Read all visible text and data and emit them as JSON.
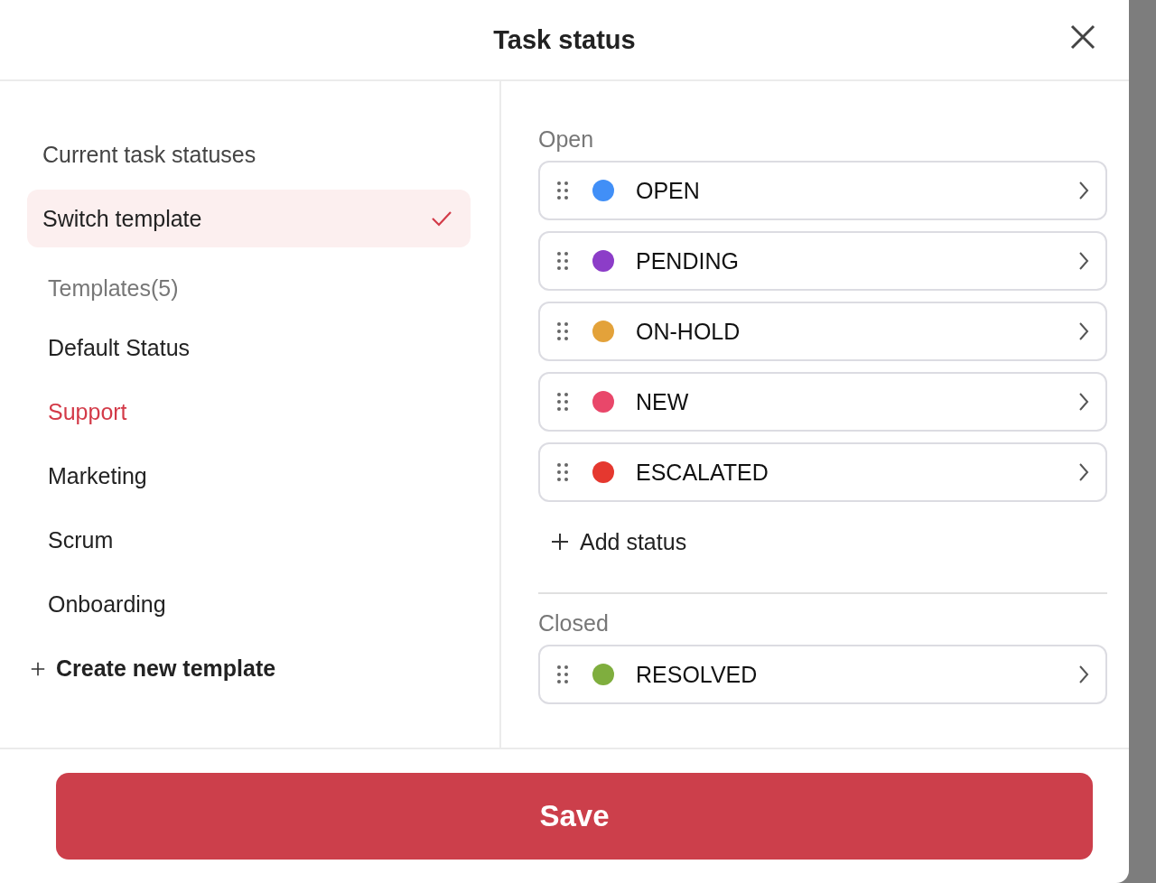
{
  "dialog": {
    "title": "Task status"
  },
  "sidebar": {
    "heading": "Current task statuses",
    "switch": {
      "label": "Switch template",
      "checked": true
    },
    "templates_label": "Templates(5)",
    "templates": [
      {
        "label": "Default Status",
        "selected": false
      },
      {
        "label": "Support",
        "selected": true
      },
      {
        "label": "Marketing",
        "selected": false
      },
      {
        "label": "Scrum",
        "selected": false
      },
      {
        "label": "Onboarding",
        "selected": false
      }
    ],
    "create": "Create new template"
  },
  "groups": [
    {
      "title": "Open",
      "add": "Add status",
      "statuses": [
        {
          "label": "OPEN",
          "color": "#418ff7"
        },
        {
          "label": "PENDING",
          "color": "#8c3dc8"
        },
        {
          "label": "ON-HOLD",
          "color": "#e3a23a"
        },
        {
          "label": "NEW",
          "color": "#e9476a"
        },
        {
          "label": "ESCALATED",
          "color": "#e5382f"
        }
      ]
    },
    {
      "title": "Closed",
      "statuses": [
        {
          "label": "RESOLVED",
          "color": "#7fae3e"
        }
      ]
    }
  ],
  "footer": {
    "save": "Save"
  }
}
